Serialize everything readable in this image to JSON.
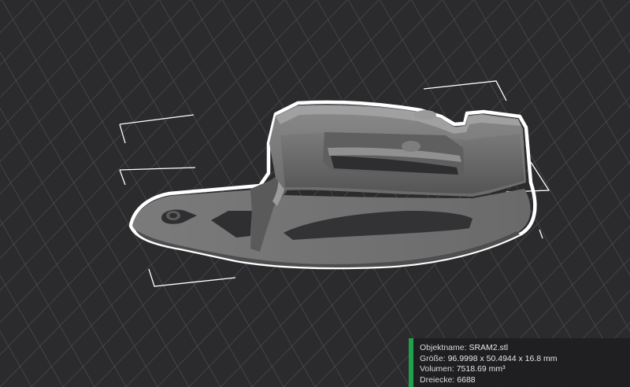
{
  "viewport": {
    "background_color": "#2b2b2e",
    "grid_color": "#4a4a4e",
    "model_color": "#6b6b6b",
    "selection_outline_color": "#ffffff",
    "bounding_box_color": "#ffffff"
  },
  "object_info": {
    "accent_color": "#1fa24a",
    "name_label": "Objektname: ",
    "name_value": "SRAM2.stl",
    "size_label": "Größe: ",
    "size_value": "96.9998 x 50.4944 x 16.8 mm",
    "volume_label": "Volumen: ",
    "volume_value": "7518.69 mm³",
    "triangles_label": "Dreiecke: ",
    "triangles_value": "6688"
  }
}
